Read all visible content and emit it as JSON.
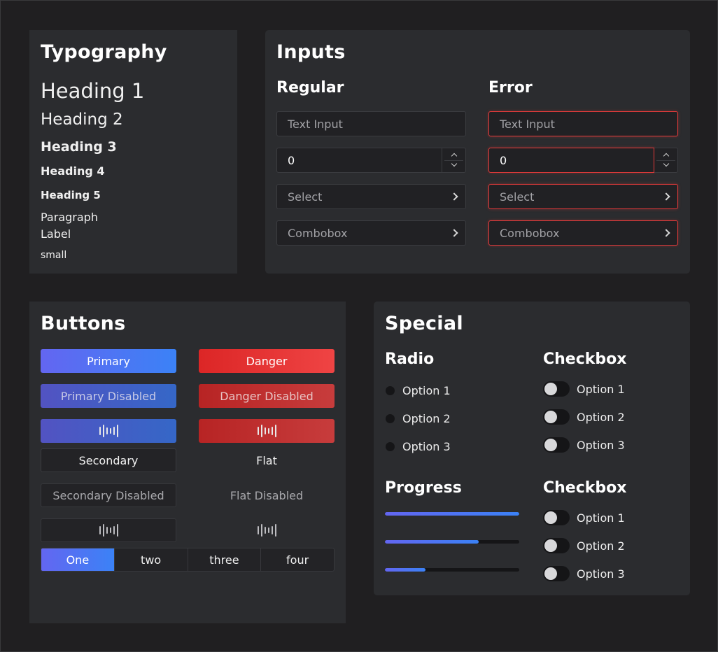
{
  "typography": {
    "title": "Typography",
    "heading1": "Heading 1",
    "heading2": "Heading 2",
    "heading3": "Heading 3",
    "heading4": "Heading 4",
    "heading5": "Heading 5",
    "paragraph": "Paragraph",
    "label": "Label",
    "small": "small"
  },
  "inputs": {
    "title": "Inputs",
    "regular": {
      "title": "Regular",
      "text_placeholder": "Text Input",
      "number_value": "0",
      "select_placeholder": "Select",
      "combobox_placeholder": "Combobox"
    },
    "error": {
      "title": "Error",
      "text_placeholder": "Text Input",
      "number_value": "0",
      "select_placeholder": "Select",
      "combobox_placeholder": "Combobox"
    }
  },
  "buttons": {
    "title": "Buttons",
    "primary": "Primary",
    "primary_disabled": "Primary Disabled",
    "danger": "Danger",
    "danger_disabled": "Danger Disabled",
    "secondary": "Secondary",
    "secondary_disabled": "Secondary Disabled",
    "flat": "Flat",
    "flat_disabled": "Flat Disabled",
    "segmented": [
      "One",
      "two",
      "three",
      "four"
    ],
    "segmented_active": 0
  },
  "special": {
    "title": "Special",
    "radio": {
      "title": "Radio",
      "options": [
        "Option 1",
        "Option 2",
        "Option 3"
      ]
    },
    "checkbox1": {
      "title": "Checkbox",
      "options": [
        "Option 1",
        "Option 2",
        "Option 3"
      ]
    },
    "progress": {
      "title": "Progress",
      "values": [
        1.0,
        0.7,
        0.3
      ]
    },
    "checkbox2": {
      "title": "Checkbox",
      "options": [
        "Option 1",
        "Option 2",
        "Option 3"
      ]
    }
  },
  "colors": {
    "background": "#201f21",
    "card": "#2b2c2f",
    "accent_start": "#6366f1",
    "accent_end": "#3b82f6",
    "danger": "#ef4444"
  }
}
